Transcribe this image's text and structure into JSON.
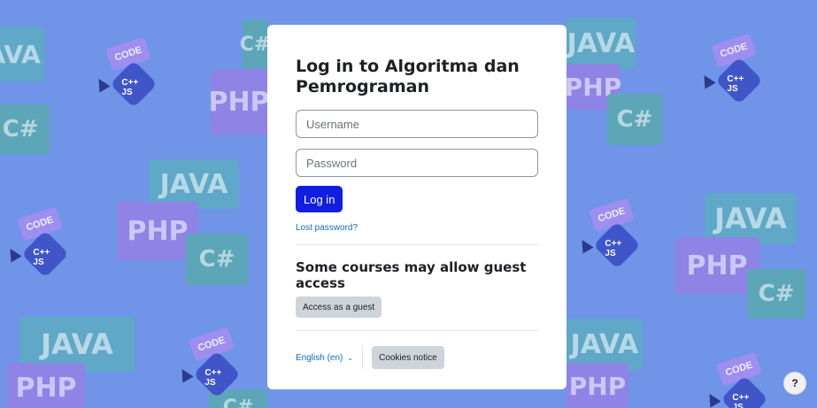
{
  "card": {
    "title": "Log in to Algoritma dan Pemrograman",
    "username_placeholder": "Username",
    "password_placeholder": "Password",
    "login_label": "Log in",
    "lost_password": "Lost password?",
    "guest_heading": "Some courses may allow guest access",
    "guest_button": "Access as a guest",
    "language": "English (en)",
    "cookies_button": "Cookies notice"
  },
  "help": {
    "label": "?"
  },
  "background": {
    "labels": {
      "java": "JAVA",
      "php": "PHP",
      "csharp": "C#",
      "code": "CODE",
      "cpp_js": "C++ JS"
    }
  },
  "colors": {
    "background": "#6f94e8",
    "login_button": "#0f1ee0",
    "link": "#0f6cbf"
  },
  "icons": {
    "language_chevron": "chevron-down-icon",
    "help": "question-icon"
  }
}
